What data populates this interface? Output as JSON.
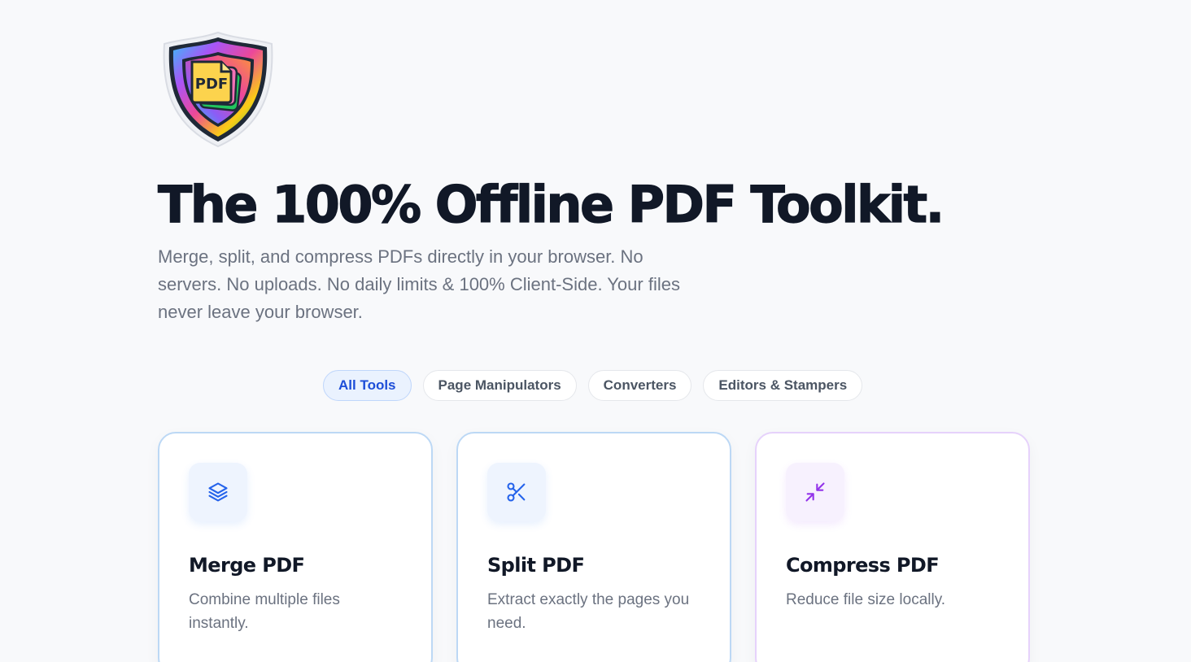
{
  "hero": {
    "logo_text": "PDF",
    "title": "The 100% Offline PDF Toolkit.",
    "subtitle": "Merge, split, and compress PDFs directly in your browser. No servers. No uploads. No daily limits & 100% Client-Side. Your files never leave your browser."
  },
  "filters": [
    {
      "label": "All Tools",
      "active": true
    },
    {
      "label": "Page Manipulators",
      "active": false
    },
    {
      "label": "Converters",
      "active": false
    },
    {
      "label": "Editors & Stampers",
      "active": false
    }
  ],
  "tools": [
    {
      "title": "Merge PDF",
      "description": "Combine multiple files instantly.",
      "icon": "layers-icon",
      "accent": "#2563eb"
    },
    {
      "title": "Split PDF",
      "description": "Extract exactly the pages you need.",
      "icon": "scissors-icon",
      "accent": "#2563eb"
    },
    {
      "title": "Compress PDF",
      "description": "Reduce file size locally.",
      "icon": "minimize-icon",
      "accent": "#9333ea"
    }
  ],
  "colors": {
    "background": "#f8f9fb",
    "heading": "#111827",
    "body_text": "#6b7280",
    "active_pill_bg": "#eaf2fe",
    "active_pill_text": "#1d4ed8",
    "card_border_blue": "#bcd8f5",
    "card_border_purple": "#e6d2fb"
  }
}
